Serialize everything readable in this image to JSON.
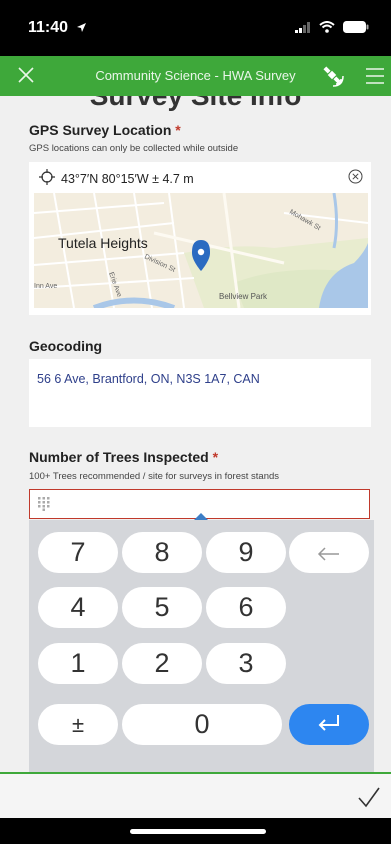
{
  "status_bar": {
    "time": "11:40",
    "location_icon": "location-arrow-icon",
    "signal_icon": "signal-icon",
    "wifi_icon": "wifi-icon",
    "battery_icon": "battery-icon"
  },
  "app_bar": {
    "title": "Community Science - HWA Survey",
    "close_icon": "close-icon",
    "gps_icon": "satellite-icon",
    "menu_icon": "menu-icon",
    "bg": "#3ea83a"
  },
  "page": {
    "title": "Survey Site Info"
  },
  "gps_field": {
    "label": "GPS Survey Location",
    "required_mark": "*",
    "hint": "GPS locations can only be collected while outside",
    "coordinates": "43°7′N 80°15′W ± 4.7 m",
    "map": {
      "place_label": "Tutela Heights",
      "park_label": "Bellview Park",
      "streets": [
        "Division St",
        "Erie Ave",
        "Inn Ave",
        "Mohawk St"
      ]
    }
  },
  "geocoding_field": {
    "label": "Geocoding",
    "value": "56 6 Ave, Brantford, ON, N3S 1A7, CAN"
  },
  "trees_field": {
    "label": "Number of Trees Inspected",
    "required_mark": "*",
    "hint": "100+ Trees recommended / site for surveys in forest stands",
    "value": ""
  },
  "keypad": {
    "keys": [
      "7",
      "8",
      "9",
      "4",
      "5",
      "6",
      "1",
      "2",
      "3",
      "±",
      "0"
    ],
    "backspace_icon": "backspace-icon",
    "enter_icon": "return-icon",
    "accent": "#2d86f0"
  },
  "bottom_bar": {
    "submit_icon": "checkmark-icon"
  }
}
